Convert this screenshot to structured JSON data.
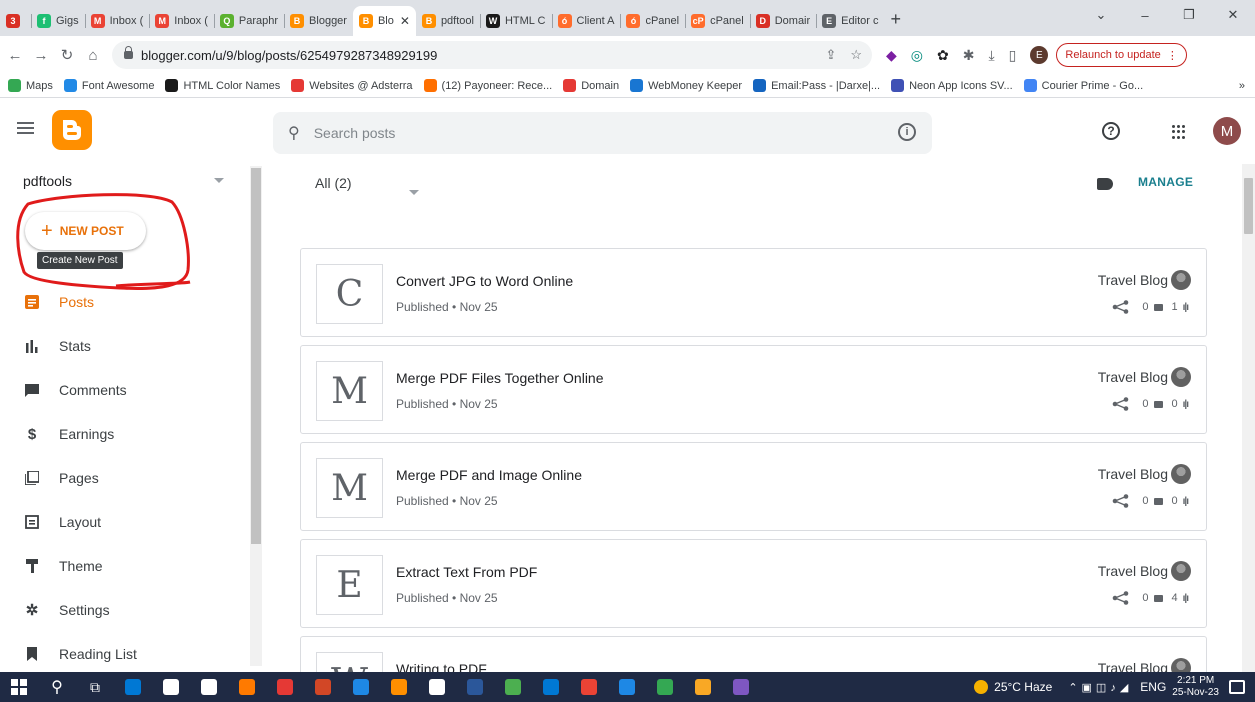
{
  "browser": {
    "tabs": [
      {
        "label": "",
        "color": "#d93025",
        "glyph": "3",
        "active": false
      },
      {
        "label": "Gigs",
        "color": "#1dbf73",
        "glyph": "f",
        "active": false
      },
      {
        "label": "Inbox (",
        "color": "#ea4335",
        "glyph": "M",
        "active": false
      },
      {
        "label": "Inbox (",
        "color": "#ea4335",
        "glyph": "M",
        "active": false
      },
      {
        "label": "Paraphr",
        "color": "#5bb12f",
        "glyph": "Q",
        "active": false
      },
      {
        "label": "Blogger",
        "color": "#ff8f00",
        "glyph": "B",
        "active": false
      },
      {
        "label": "Blo",
        "color": "#ff8f00",
        "glyph": "B",
        "active": true
      },
      {
        "label": "pdftool",
        "color": "#ff8f00",
        "glyph": "B",
        "active": false
      },
      {
        "label": "HTML C",
        "color": "#1a1a1a",
        "glyph": "W",
        "active": false
      },
      {
        "label": "Client A",
        "color": "#ff6c2c",
        "glyph": "ó",
        "active": false
      },
      {
        "label": "cPanel",
        "color": "#ff6c2c",
        "glyph": "ó",
        "active": false
      },
      {
        "label": "cPanel",
        "color": "#ff6c2c",
        "glyph": "cP",
        "active": false
      },
      {
        "label": "Domair",
        "color": "#d93025",
        "glyph": "D",
        "active": false
      },
      {
        "label": "Editor c",
        "color": "#5f6368",
        "glyph": "E",
        "active": false
      }
    ],
    "new_tab": "+",
    "window_controls": {
      "chevron": "⌄",
      "minimize": "–",
      "restore": "❐",
      "close": "✕"
    },
    "url": "blogger.com/u/9/blog/posts/6254979287348929199",
    "relaunch_label": "Relaunch to update",
    "profile_initial": "E",
    "bookmarks": [
      {
        "label": "Maps",
        "color": "#34a853"
      },
      {
        "label": "Font Awesome",
        "color": "#228ae6"
      },
      {
        "label": "HTML Color Names",
        "color": "#1a1a1a"
      },
      {
        "label": "Websites @ Adsterra",
        "color": "#e53935"
      },
      {
        "label": "(12) Payoneer: Rece...",
        "color": "#ff6f00"
      },
      {
        "label": "Domain",
        "color": "#e53935"
      },
      {
        "label": "WebMoney Keeper",
        "color": "#1976d2"
      },
      {
        "label": "Email:Pass - |Darxe|...",
        "color": "#1565c0"
      },
      {
        "label": "Neon App Icons SV...",
        "color": "#3f51b5"
      },
      {
        "label": "Courier Prime - Go...",
        "color": "#4285f4"
      }
    ],
    "bookmarks_more": "»"
  },
  "header": {
    "search_placeholder": "Search posts",
    "avatar_initial": "M"
  },
  "sidebar": {
    "blog_name": "pdftools",
    "new_post_label": "NEW POST",
    "new_post_icon": "+",
    "tooltip": "Create New Post",
    "items": [
      {
        "label": "Posts",
        "icon": "posts-icon",
        "active": true
      },
      {
        "label": "Stats",
        "icon": "stats-icon",
        "active": false
      },
      {
        "label": "Comments",
        "icon": "comments-icon",
        "active": false
      },
      {
        "label": "Earnings",
        "icon": "earnings-icon",
        "active": false
      },
      {
        "label": "Pages",
        "icon": "pages-icon",
        "active": false
      },
      {
        "label": "Layout",
        "icon": "layout-icon",
        "active": false
      },
      {
        "label": "Theme",
        "icon": "theme-icon",
        "active": false
      },
      {
        "label": "Settings",
        "icon": "settings-icon",
        "active": false
      },
      {
        "label": "Reading List",
        "icon": "reading-list-icon",
        "active": false
      }
    ]
  },
  "main": {
    "filter_label": "All (2)",
    "manage_label": "MANAGE",
    "posts": [
      {
        "initial": "C",
        "title": "Convert JPG to Word Online",
        "status": "Published • Nov 25",
        "blog": "Travel Blog",
        "shares": "",
        "comments": "0",
        "views": "1"
      },
      {
        "initial": "M",
        "title": "Merge PDF Files Together Online",
        "status": "Published • Nov 25",
        "blog": "Travel Blog",
        "shares": "",
        "comments": "0",
        "views": "0"
      },
      {
        "initial": "M",
        "title": "Merge PDF and Image Online",
        "status": "Published • Nov 25",
        "blog": "Travel Blog",
        "shares": "",
        "comments": "0",
        "views": "0"
      },
      {
        "initial": "E",
        "title": "Extract Text From PDF",
        "status": "Published • Nov 25",
        "blog": "Travel Blog",
        "shares": "",
        "comments": "0",
        "views": "4"
      },
      {
        "initial": "W",
        "title": "Writing to PDF",
        "status": "",
        "blog": "Travel Blog",
        "shares": "",
        "comments": "",
        "views": ""
      }
    ]
  },
  "taskbar": {
    "apps": [
      "#0078d4",
      "#ffffff",
      "#ffffff",
      "#ff7a00",
      "#e53935",
      "#d24726",
      "#1e88e5",
      "#ff8f00",
      "#ffffff",
      "#2b579a",
      "#4caf50",
      "#0078d4",
      "#ea4335",
      "#1e88e5",
      "#34a853",
      "#f9a825",
      "#7e57c2"
    ],
    "weather": "25°C  Haze",
    "language": "ENG",
    "time": "2:21 PM",
    "date": "25-Nov-23"
  },
  "colors": {
    "accent": "#e8710a",
    "brand": "#ff8f00",
    "annotation": "#e01b1b",
    "manage": "#1a7f8e"
  }
}
